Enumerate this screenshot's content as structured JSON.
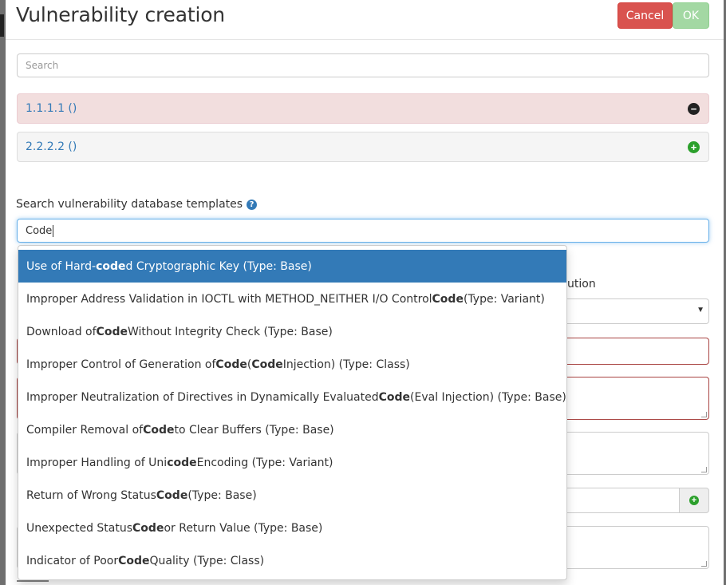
{
  "modal": {
    "title": "Vulnerability creation",
    "cancel_label": "Cancel",
    "ok_label": "OK"
  },
  "search": {
    "placeholder": "Search"
  },
  "targets": [
    {
      "label": "1.1.1.1 ()",
      "state": "expanded",
      "icon": "minus-circle-icon"
    },
    {
      "label": "2.2.2.2 ()",
      "state": "collapsed",
      "icon": "plus-circle-icon"
    }
  ],
  "templates": {
    "label": "Search vulnerability database templates",
    "help_icon": "question-circle-icon",
    "query": "Code"
  },
  "background": {
    "partial_label": "ution"
  },
  "suggestions": [
    {
      "before": "Use of Hard-",
      "match": "code",
      "after": "d Cryptographic Key (Type: Base)",
      "active": true
    },
    {
      "before": "Improper Address Validation in IOCTL with METHOD_NEITHER I/O Control ",
      "match": "Code",
      "after": " (Type: Variant)"
    },
    {
      "before": "Download of ",
      "match": "Code",
      "after": " Without Integrity Check (Type: Base)"
    },
    {
      "before": "Improper Control of Generation of ",
      "match": "Code",
      "mid": " (",
      "match2": "Code",
      "after": " Injection) (Type: Class)"
    },
    {
      "before": "Improper Neutralization of Directives in Dynamically Evaluated ",
      "match": "Code",
      "after": " (Eval Injection) (Type: Base)"
    },
    {
      "before": "Compiler Removal of ",
      "match": "Code",
      "after": " to Clear Buffers (Type: Base)"
    },
    {
      "before": "Improper Handling of Uni",
      "match": "code",
      "after": " Encoding (Type: Variant)"
    },
    {
      "before": "Return of Wrong Status ",
      "match": "Code",
      "after": " (Type: Base)"
    },
    {
      "before": "Unexpected Status ",
      "match": "Code",
      "after": " or Return Value (Type: Base)"
    },
    {
      "before": "Indicator of Poor ",
      "match": "Code",
      "after": " Quality (Type: Class)"
    }
  ],
  "colors": {
    "danger": "#d9534f",
    "success_disabled": "#a3d8a3",
    "primary": "#337ab7",
    "panel_danger_bg": "#f2dede"
  }
}
